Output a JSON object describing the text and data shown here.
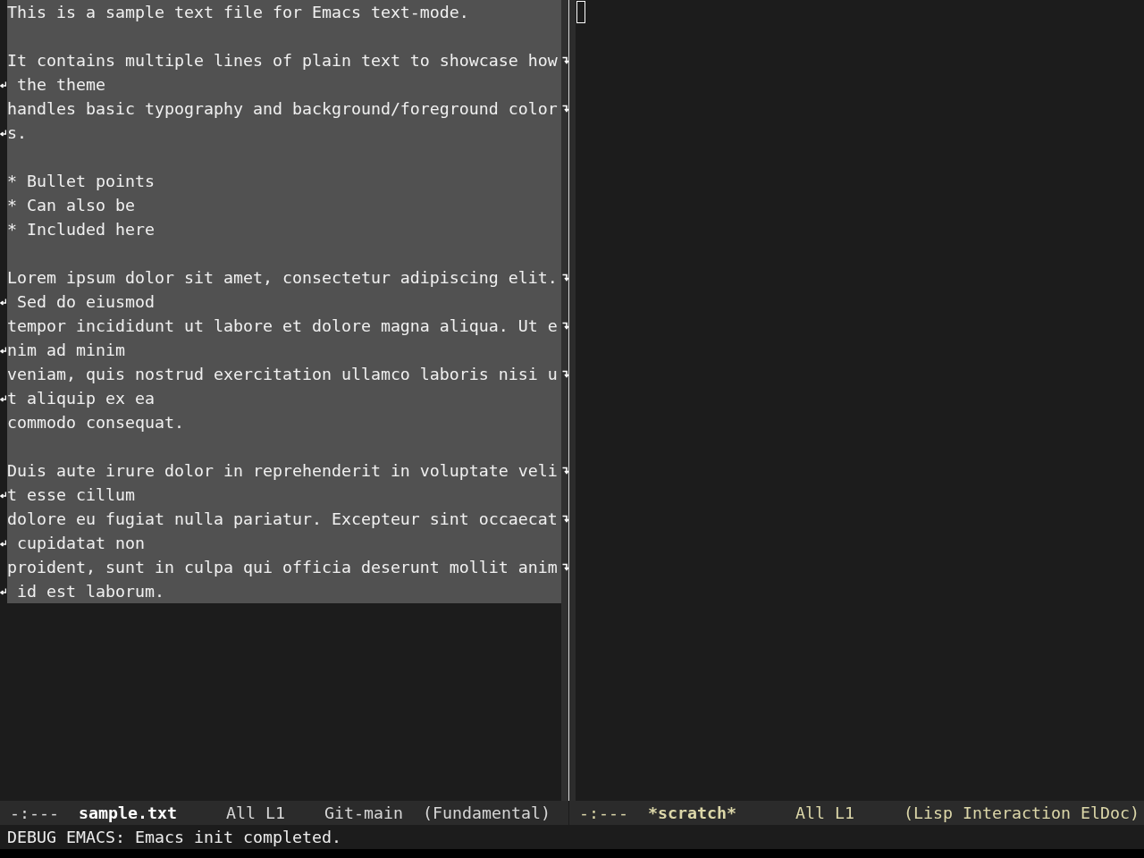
{
  "left_window": {
    "selected": true,
    "region_selected": true,
    "lines": [
      {
        "kind": "text",
        "rows": [
          "This is a sample text file for Emacs text-mode."
        ]
      },
      {
        "kind": "blank"
      },
      {
        "kind": "text",
        "rows": [
          "It contains multiple lines of plain text to showcase how",
          " the theme"
        ]
      },
      {
        "kind": "text",
        "rows": [
          "handles basic typography and background/foreground color",
          "s."
        ]
      },
      {
        "kind": "blank"
      },
      {
        "kind": "text",
        "rows": [
          "* Bullet points"
        ]
      },
      {
        "kind": "text",
        "rows": [
          "* Can also be"
        ]
      },
      {
        "kind": "text",
        "rows": [
          "* Included here"
        ]
      },
      {
        "kind": "blank"
      },
      {
        "kind": "text",
        "rows": [
          "Lorem ipsum dolor sit amet, consectetur adipiscing elit.",
          " Sed do eiusmod"
        ]
      },
      {
        "kind": "text",
        "rows": [
          "tempor incididunt ut labore et dolore magna aliqua. Ut e",
          "nim ad minim"
        ]
      },
      {
        "kind": "text",
        "rows": [
          "veniam, quis nostrud exercitation ullamco laboris nisi u",
          "t aliquip ex ea"
        ]
      },
      {
        "kind": "text",
        "rows": [
          "commodo consequat."
        ]
      },
      {
        "kind": "blank"
      },
      {
        "kind": "text",
        "rows": [
          "Duis aute irure dolor in reprehenderit in voluptate veli",
          "t esse cillum"
        ]
      },
      {
        "kind": "text",
        "rows": [
          "dolore eu fugiat nulla pariatur. Excepteur sint occaecat",
          " cupidatat non"
        ]
      },
      {
        "kind": "text",
        "rows": [
          "proident, sunt in culpa qui officia deserunt mollit anim",
          " id est laborum."
        ]
      }
    ],
    "mode_line": [
      {
        "kind": "status",
        "text": "-:---"
      },
      {
        "kind": "buffer",
        "text": "sample.txt"
      },
      {
        "kind": "position",
        "text": "All L1"
      },
      {
        "kind": "vc",
        "text": "Git-main"
      },
      {
        "kind": "mode",
        "text": "(Fundamental)"
      }
    ]
  },
  "right_window": {
    "selected": false,
    "cursor_shown": true,
    "mode_line": [
      {
        "kind": "status",
        "text": "-:---"
      },
      {
        "kind": "buffer",
        "text": "*scratch*"
      },
      {
        "kind": "position",
        "text": "All L1"
      },
      {
        "kind": "mode",
        "text": "(Lisp Interaction ElDoc)"
      }
    ]
  },
  "echo_area": {
    "message": "DEBUG EMACS: Emacs init completed."
  }
}
